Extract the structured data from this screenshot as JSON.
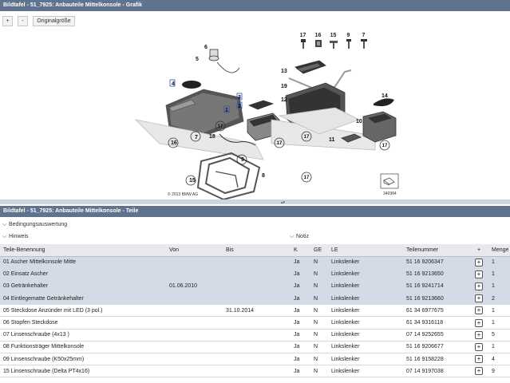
{
  "top_panel": {
    "title": "Bildtafel - 51_7925: Anbauteile Mittelkonsole - Grafik",
    "zoom_in_label": "+",
    "zoom_out_label": "-",
    "original_size_label": "Originalgröße"
  },
  "diagram": {
    "copyright": "© 2013 BMW AG",
    "ref_number": "346984",
    "legend": [
      "17",
      "16",
      "15",
      "9",
      "7"
    ],
    "callouts": [
      "1",
      "2",
      "3",
      "4",
      "5",
      "6",
      "7",
      "8",
      "9",
      "10",
      "11",
      "12",
      "13",
      "14",
      "15",
      "16",
      "17",
      "18",
      "19"
    ]
  },
  "bottom_panel": {
    "title": "Bildtafel - 51_7925: Anbauteile Mittelkonsole - Teile",
    "filter_conditions": "Bedingungsauswertung",
    "filter_hints": "Hinweis",
    "filter_notes": "Notiz"
  },
  "table": {
    "headers": [
      "Teile-Benennung",
      "Von",
      "Bis",
      "K",
      "GE",
      "LE",
      "Teilenummer",
      "+",
      "Menge"
    ],
    "rows": [
      {
        "name": "01 Ascher Mittelkonsole Mitte",
        "von": "",
        "bis": "",
        "k": "Ja",
        "ge": "N",
        "le": "Linkslenker",
        "part": "51 16 9206347",
        "qty": "1",
        "highlighted": true
      },
      {
        "name": "02 Einsatz Ascher",
        "von": "",
        "bis": "",
        "k": "Ja",
        "ge": "N",
        "le": "Linkslenker",
        "part": "51 16 9213650",
        "qty": "1",
        "highlighted": true
      },
      {
        "name": "03 Getränkehalter",
        "von": "01.06.2010",
        "bis": "",
        "k": "Ja",
        "ge": "N",
        "le": "Linkslenker",
        "part": "51 16 9241714",
        "qty": "1",
        "highlighted": true
      },
      {
        "name": "04 Eintlegematte Getränkehalter",
        "von": "",
        "bis": "",
        "k": "Ja",
        "ge": "N",
        "le": "Linkslenker",
        "part": "51 16 9213660",
        "qty": "2",
        "highlighted": true
      },
      {
        "name": "05 Steckdose Anzünder mit LED (3 pol.)",
        "von": "",
        "bis": "31.10.2014",
        "k": "Ja",
        "ge": "N",
        "le": "Linkslenker",
        "part": "61 34 6977675",
        "qty": "1",
        "highlighted": false
      },
      {
        "name": "06 Stopfen Steckdose",
        "von": "",
        "bis": "",
        "k": "Ja",
        "ge": "N",
        "le": "Linkslenker",
        "part": "61 34 9316118",
        "qty": "1",
        "highlighted": false
      },
      {
        "name": "07 Linsenschraube (4x13 )",
        "von": "",
        "bis": "",
        "k": "Ja",
        "ge": "N",
        "le": "Linkslenker",
        "part": "07 14 9252655",
        "qty": "5",
        "highlighted": false
      },
      {
        "name": "08 Funktionsträger Mittelkonsole",
        "von": "",
        "bis": "",
        "k": "Ja",
        "ge": "N",
        "le": "Linkslenker",
        "part": "51 16 9206677",
        "qty": "1",
        "highlighted": false
      },
      {
        "name": "09 Linsenschraube (K50x25mm)",
        "von": "",
        "bis": "",
        "k": "Ja",
        "ge": "N",
        "le": "Linkslenker",
        "part": "51 16 9158228",
        "qty": "4",
        "highlighted": false
      },
      {
        "name": "15 Linsenschraube (Delta PT4x16)",
        "von": "",
        "bis": "",
        "k": "Ja",
        "ge": "N",
        "le": "Linkslenker",
        "part": "07 14 9197038",
        "qty": "9",
        "highlighted": false
      }
    ]
  }
}
